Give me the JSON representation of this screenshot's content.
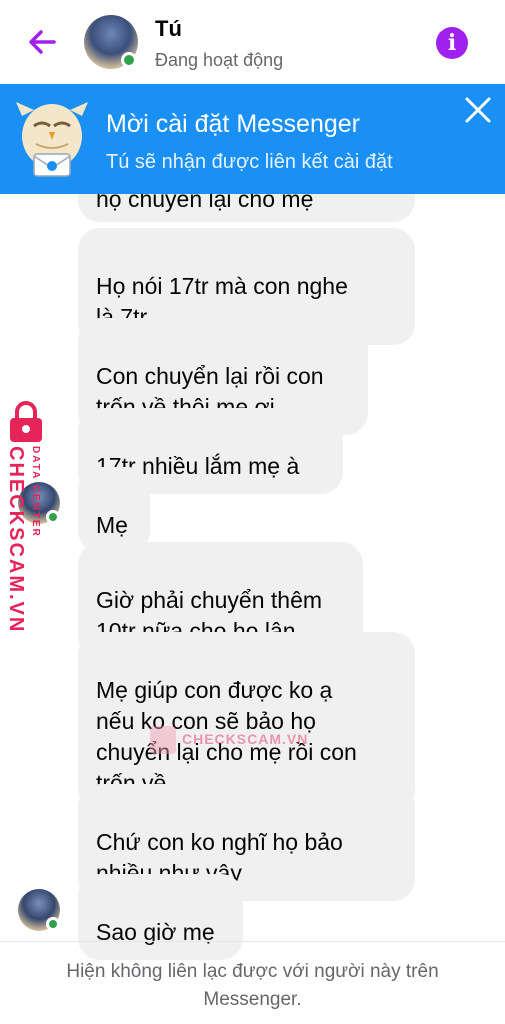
{
  "header": {
    "name": "Tú",
    "status": "Đang hoạt động"
  },
  "banner": {
    "title": "Mời cài đặt Messenger",
    "subtitle": "Tú sẽ nhận được liên kết cài đặt"
  },
  "messages": [
    {
      "text": "họ chuyển lại cho mẹ"
    },
    {
      "text": "Họ nói 17tr mà con nghe\nlà 7tr"
    },
    {
      "text": "Con chuyển lại rồi con\ntrốn về thôi mẹ ơi"
    },
    {
      "text": "17tr nhiều lắm mẹ à"
    },
    {
      "text": "Mẹ"
    },
    {
      "text": "Giờ phải chuyển thêm\n10tr nữa cho họ lận"
    },
    {
      "text": "Mẹ giúp con được ko ạ\nnếu ko con sẽ bảo họ\nchuyển lại cho mẹ rồi con\ntrốn về"
    },
    {
      "text": "Chứ con ko nghĩ họ bảo\nnhiều như vậy"
    },
    {
      "text": "Sao giờ mẹ"
    }
  ],
  "watermark": {
    "small": "DATA CENTER",
    "big": "CHECKSCAM.VN",
    "center": "CHECKSCAM.VN"
  },
  "footer": {
    "notice": "Hiện không liên lạc được với người này trên Messenger."
  },
  "colors": {
    "accent": "#a020f0",
    "banner": "#1a90f5",
    "bubble": "#f0f0f0",
    "online": "#31a24c",
    "watermark": "#e6245a"
  }
}
